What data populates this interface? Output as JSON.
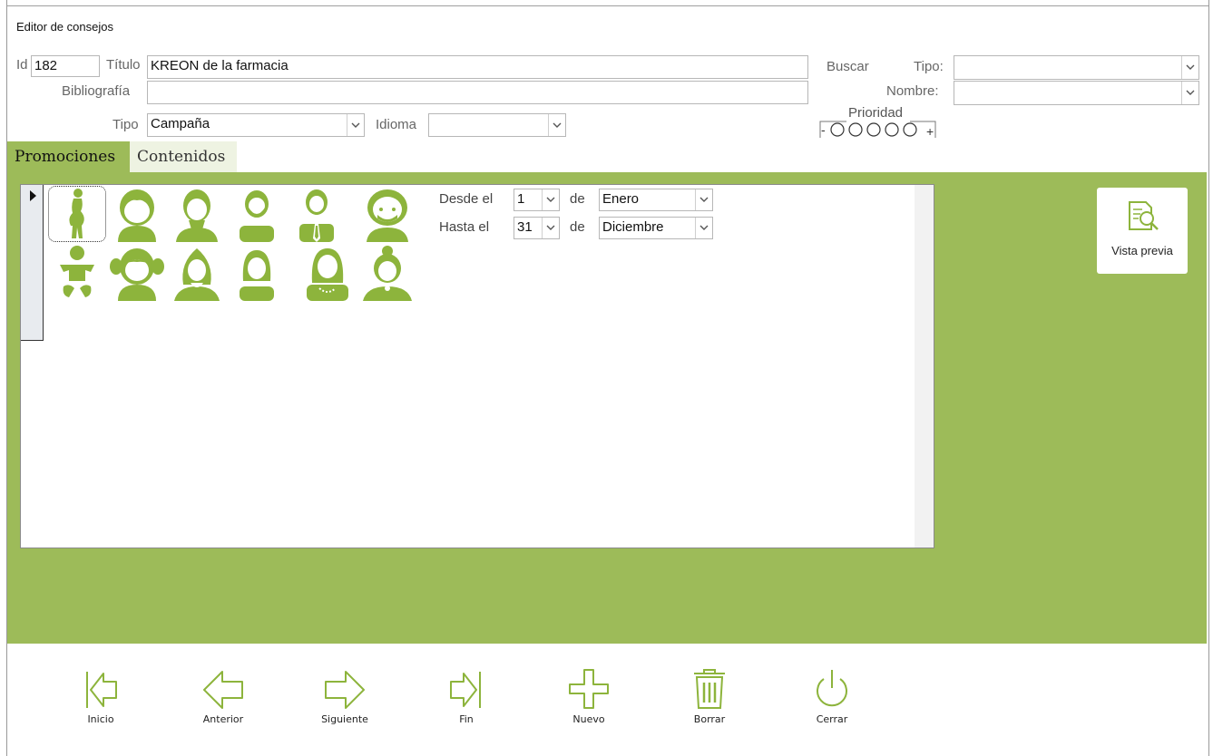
{
  "window": {
    "title": "Editor de consejos"
  },
  "header": {
    "id_label": "Id",
    "id_value": "182",
    "titulo_label": "Título",
    "titulo_value": "KREON de la farmacia",
    "bibliografia_label": "Bibliografía",
    "bibliografia_value": "",
    "tipo_label": "Tipo",
    "tipo_value": "Campaña",
    "idioma_label": "Idioma",
    "idioma_value": ""
  },
  "search": {
    "buscar_label": "Buscar",
    "tipo_label": "Tipo:",
    "tipo_value": "",
    "nombre_label": "Nombre:",
    "nombre_value": ""
  },
  "priority": {
    "label": "Prioridad",
    "minus": "-",
    "plus": "+",
    "level": 0,
    "max": 5
  },
  "tabs": [
    {
      "label": "Promociones",
      "active": true
    },
    {
      "label": "Contenidos",
      "active": false
    }
  ],
  "promo": {
    "desde_label": "Desde el",
    "desde_day": "1",
    "de_label_1": "de",
    "desde_month": "Enero",
    "hasta_label": "Hasta el",
    "hasta_day": "31",
    "de_label_2": "de",
    "hasta_month": "Diciembre",
    "avatars": [
      "pregnant-woman-icon",
      "boy-icon",
      "young-man-icon",
      "bearded-man-icon",
      "man-with-tie-icon",
      "elderly-man-icon",
      "baby-icon",
      "girl-icon",
      "young-woman-icon",
      "woman-icon",
      "woman-with-necklace-icon",
      "elderly-woman-icon"
    ]
  },
  "side": {
    "preview_label": "Vista previa"
  },
  "nav": {
    "inicio": "Inicio",
    "anterior": "Anterior",
    "siguiente": "Siguiente",
    "fin": "Fin",
    "nuevo": "Nuevo",
    "borrar": "Borrar",
    "cerrar": "Cerrar"
  },
  "colors": {
    "accent": "#9dbb59",
    "icon": "#8db43c"
  }
}
